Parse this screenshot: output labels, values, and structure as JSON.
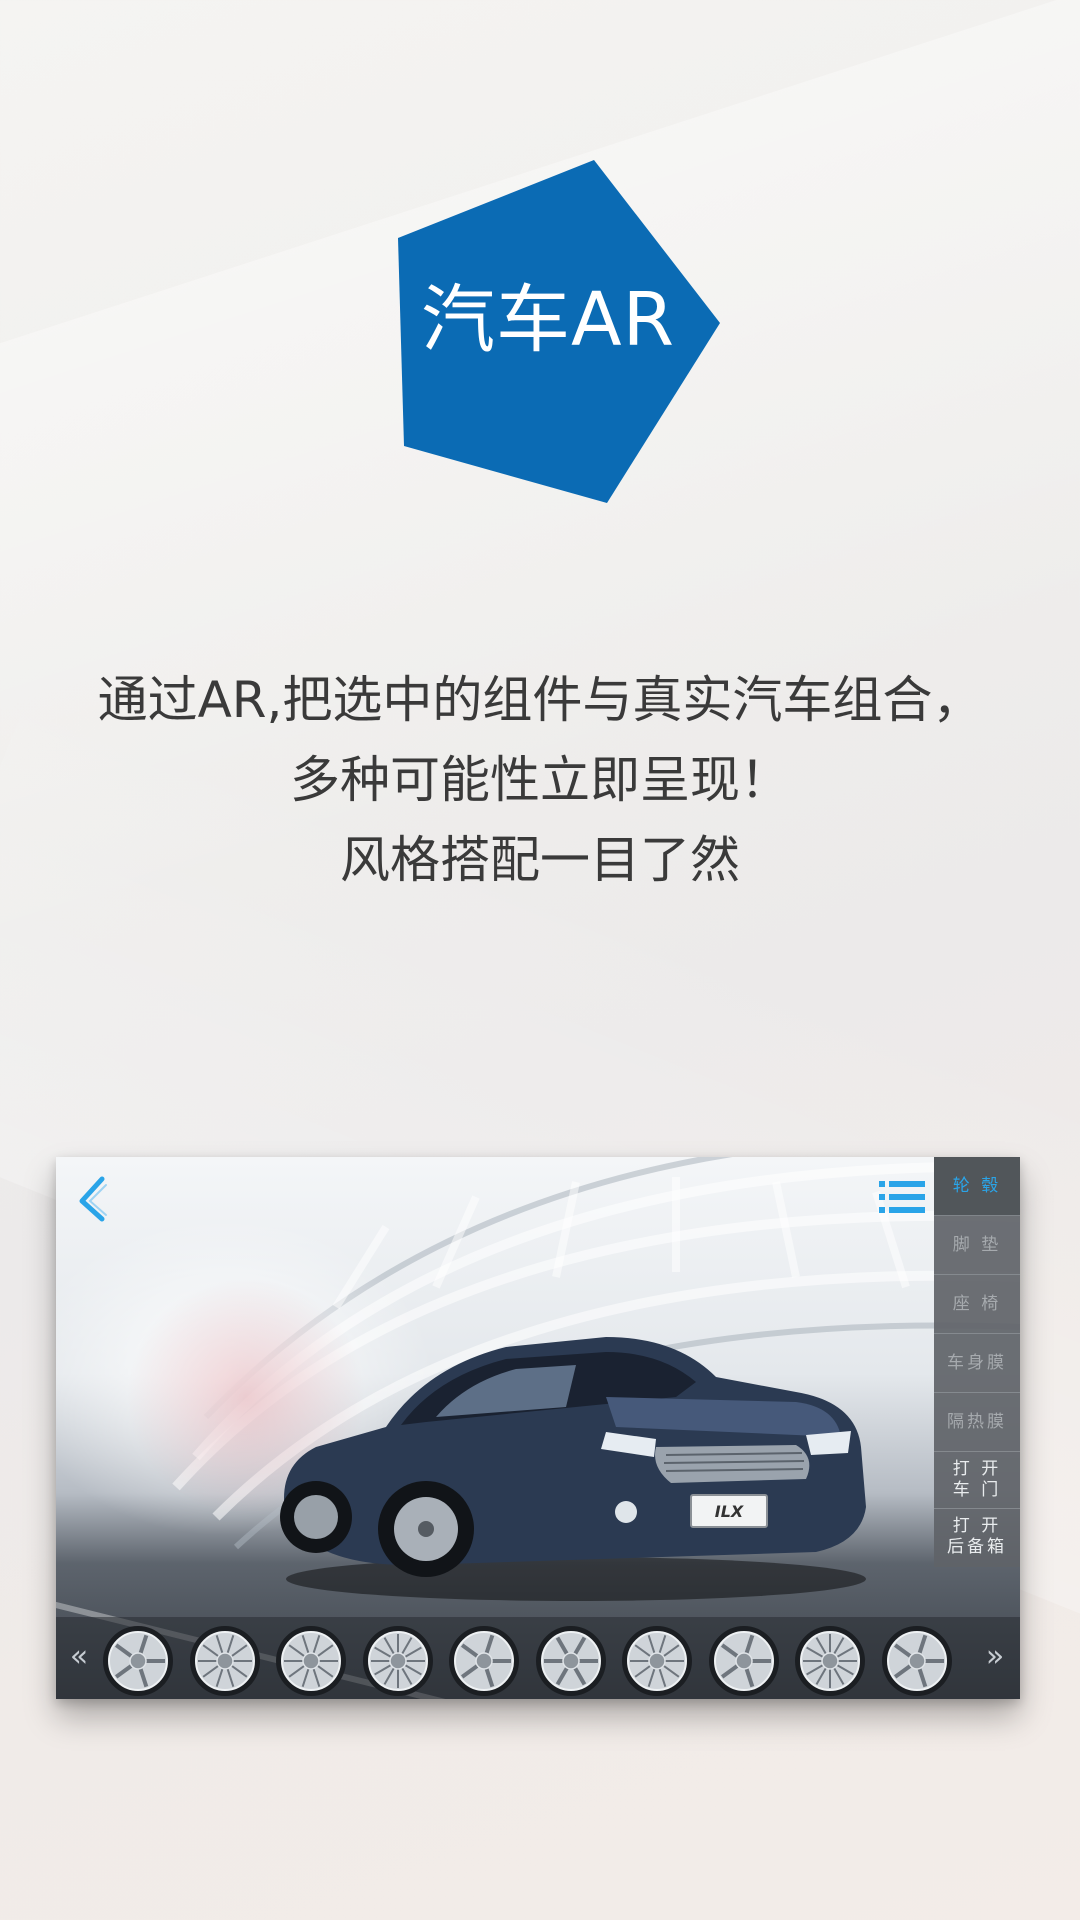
{
  "badge": {
    "title": "汽车AR",
    "color": "#0b6bb4"
  },
  "description": {
    "line1": "通过AR,把选中的组件与真实汽车组合，",
    "line2": "多种可能性立即呈现！",
    "line3": "风格搭配一目了然"
  },
  "app_screen": {
    "back_icon": "back-chevron-icon",
    "menu_icon": "list-menu-icon",
    "accent_color": "#2aa4e8",
    "car_badge": "ILX",
    "side_menu": {
      "items": [
        {
          "label": "轮 毂",
          "active": true
        },
        {
          "label": "脚 垫"
        },
        {
          "label": "座 椅"
        },
        {
          "label": "车身膜"
        },
        {
          "label": "隔热膜"
        }
      ],
      "open_door": {
        "line1": "打 开",
        "line2": "车 门"
      },
      "open_trunk": {
        "line1": "打 开",
        "line2": "后备箱"
      }
    },
    "wheel_strip": {
      "prev_label": "«",
      "next_label": "»",
      "wheel_count": 10
    }
  }
}
